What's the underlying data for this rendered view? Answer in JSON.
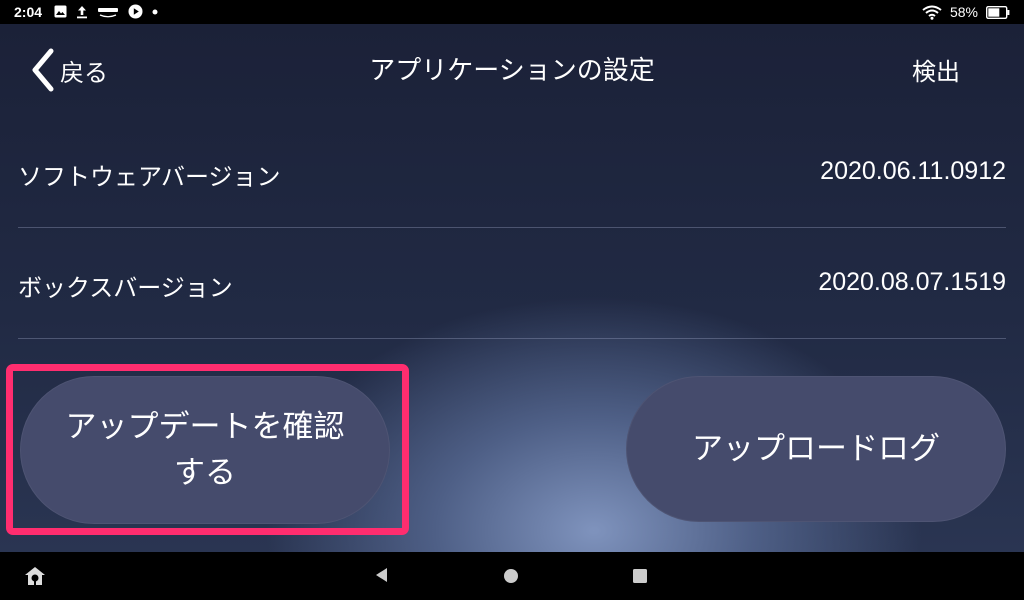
{
  "status_bar": {
    "time": "2:04",
    "battery_percent": "58%",
    "notification_icons": [
      "image-icon",
      "upload-icon",
      "photos-icon",
      "play-icon",
      "dot-icon"
    ],
    "right_icons": [
      "wifi-icon",
      "battery-icon"
    ]
  },
  "header": {
    "back_label": "戻る",
    "title": "アプリケーションの設定",
    "detect_label": "検出"
  },
  "rows": [
    {
      "label": "ソフトウェアバージョン",
      "value": "2020.06.11.0912"
    },
    {
      "label": "ボックスバージョン",
      "value": "2020.08.07.1519"
    }
  ],
  "buttons": {
    "check_update_line1": "アップデートを確認",
    "check_update_line2": "する",
    "upload_log": "アップロードログ"
  },
  "colors": {
    "highlight": "#ff2d6f",
    "button_bg": "#454b6c",
    "app_bg": "#212a44"
  },
  "nav_bar": {
    "icons": [
      "home-settings-icon",
      "nav-back-icon",
      "nav-home-icon",
      "nav-recents-icon"
    ]
  }
}
